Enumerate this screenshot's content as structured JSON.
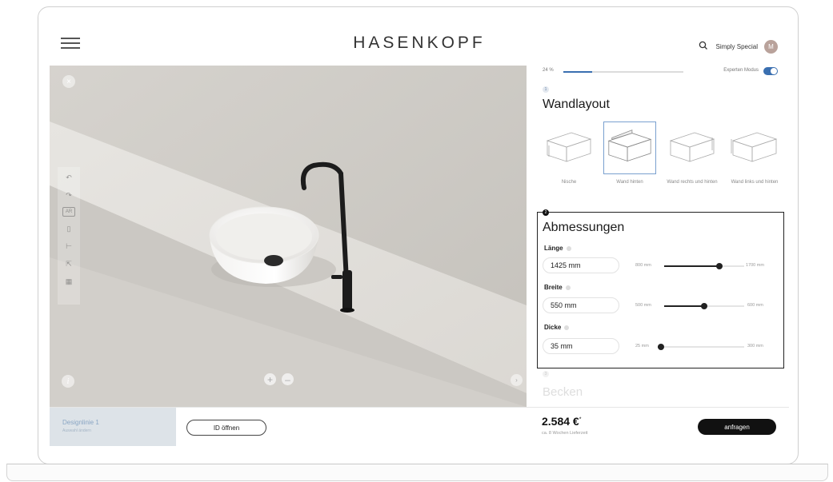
{
  "header": {
    "logo": "HASENKOPF",
    "profile_name": "Simply Special",
    "avatar_initial": "M"
  },
  "viewer": {
    "close_label": "×",
    "info_label": "i",
    "zoom_in_label": "+",
    "zoom_out_label": "–",
    "next_label": "›",
    "tools": [
      "undo-icon",
      "redo-icon",
      "ar-icon",
      "trash-icon",
      "ruler-icon",
      "share-icon",
      "grid-icon"
    ],
    "ar_label": "AR"
  },
  "panel": {
    "progress_percent_label": "24 %",
    "progress_value": 0.24,
    "expert_mode_label": "Experten Modus",
    "expert_mode_on": true,
    "step1_number": "1",
    "layout_title": "Wandlayout",
    "layout_options": [
      {
        "label": "Nische",
        "selected": false
      },
      {
        "label": "Wand hinten",
        "selected": true
      },
      {
        "label": "Wand rechts und hinten",
        "selected": false
      },
      {
        "label": "Wand links und hinten",
        "selected": false
      }
    ],
    "step2_number": "2",
    "dimensions_title": "Abmessungen",
    "dimensions": [
      {
        "label": "Länge",
        "value": "1425 mm",
        "min_label": "800 mm",
        "max_label": "1700 mm",
        "min": 800,
        "max": 1700,
        "current": 1425
      },
      {
        "label": "Breite",
        "value": "550 mm",
        "min_label": "500 mm",
        "max_label": "600 mm",
        "min": 500,
        "max": 600,
        "current": 550
      },
      {
        "label": "Dicke",
        "value": "35 mm",
        "min_label": "25 mm",
        "max_label": "300 mm",
        "min": 25,
        "max": 300,
        "current": 35
      }
    ],
    "step3_number": "3",
    "basin_title": "Becken"
  },
  "footer": {
    "design_line_title": "Designlinie 1",
    "design_line_sub": "Auswahl ändern",
    "id_button": "ID öffnen",
    "price": "2.584 €",
    "price_note": "*",
    "delivery": "ca. 8 Wochen Lieferzeit",
    "request_button": "anfragen"
  },
  "colors": {
    "accent": "#3a6fb0",
    "dark": "#111111",
    "design_line_bg": "#dde3e8"
  }
}
